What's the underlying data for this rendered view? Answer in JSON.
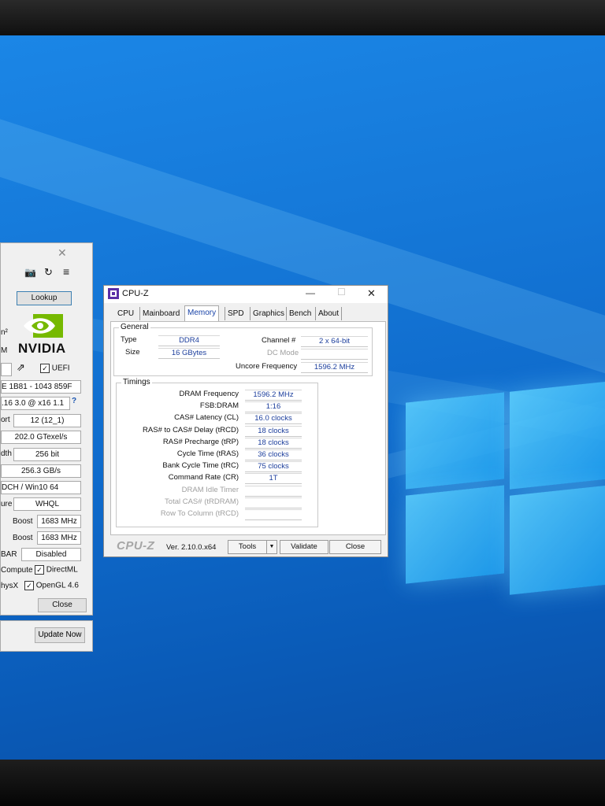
{
  "gpuz": {
    "lookup_label": "Lookup",
    "brand_text": "NVIDIA",
    "uefi_label": "UEFI",
    "bios_version": "E 1B81 - 1043 859F",
    "bus_interface": ".16 3.0 @ x16 1.1",
    "help_glyph": "?",
    "rops_label": "ort",
    "rops_value": "12 (12_1)",
    "fillrate_value": "202.0 GTexel/s",
    "bus_width_label": "dth",
    "bus_width_value": "256 bit",
    "bandwidth_value": "256.3 GB/s",
    "driver_value": "DCH / Win10 64",
    "sig_label": "ure",
    "sig_value": "WHQL",
    "boost1_label": "Boost",
    "boost1_value": "1683 MHz",
    "boost2_label": "Boost",
    "boost2_value": "1683 MHz",
    "bar_label": "BAR",
    "bar_value": "Disabled",
    "compute_label": "Compute",
    "directml_label": "DirectML",
    "physx_label": "hysX",
    "opengl_label": "OpenGL 4.6",
    "close_label": "Close",
    "update_label": "Update Now",
    "partial_label_1": "n²",
    "partial_label_2": "M"
  },
  "cpuz": {
    "title": "CPU-Z",
    "tabs": [
      "CPU",
      "Mainboard",
      "Memory",
      "SPD",
      "Graphics",
      "Bench",
      "About"
    ],
    "active_tab": "Memory",
    "general": {
      "title": "General",
      "type_label": "Type",
      "type_value": "DDR4",
      "size_label": "Size",
      "size_value": "16 GBytes",
      "channel_label": "Channel #",
      "channel_value": "2 x 64-bit",
      "dcmode_label": "DC Mode",
      "dcmode_value": "",
      "uncore_label": "Uncore Frequency",
      "uncore_value": "1596.2 MHz"
    },
    "timings": {
      "title": "Timings",
      "rows": [
        {
          "label": "DRAM Frequency",
          "value": "1596.2 MHz"
        },
        {
          "label": "FSB:DRAM",
          "value": "1:16"
        },
        {
          "label": "CAS# Latency (CL)",
          "value": "16.0 clocks"
        },
        {
          "label": "RAS# to CAS# Delay (tRCD)",
          "value": "18 clocks"
        },
        {
          "label": "RAS# Precharge (tRP)",
          "value": "18 clocks"
        },
        {
          "label": "Cycle Time (tRAS)",
          "value": "36 clocks"
        },
        {
          "label": "Bank Cycle Time (tRC)",
          "value": "75 clocks"
        },
        {
          "label": "Command Rate (CR)",
          "value": "1T"
        },
        {
          "label": "DRAM Idle Timer",
          "value": ""
        },
        {
          "label": "Total CAS# (tRDRAM)",
          "value": ""
        },
        {
          "label": "Row To Column (tRCD)",
          "value": ""
        }
      ]
    },
    "footer": {
      "brand": "CPU-Z",
      "version": "Ver. 2.10.0.x64",
      "tools_label": "Tools",
      "validate_label": "Validate",
      "close_label": "Close"
    }
  }
}
